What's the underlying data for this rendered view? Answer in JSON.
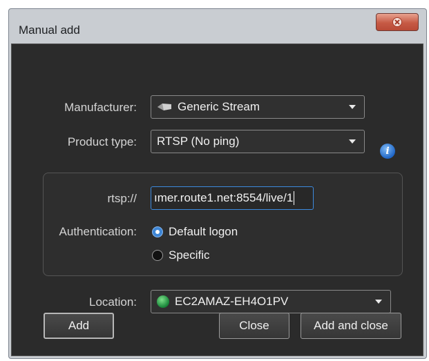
{
  "window": {
    "title": "Manual add"
  },
  "form": {
    "manufacturer": {
      "label": "Manufacturer:",
      "value": "Generic Stream",
      "icon": "generic-stream-icon"
    },
    "product_type": {
      "label": "Product type:",
      "value": "RTSP (No ping)"
    },
    "rtsp": {
      "label": "rtsp://",
      "value": "ımer.route1.net:8554/live/1"
    },
    "authentication": {
      "label": "Authentication:",
      "options": [
        {
          "label": "Default logon",
          "selected": true
        },
        {
          "label": "Specific",
          "selected": false
        }
      ]
    },
    "location": {
      "label": "Location:",
      "value": "EC2AMAZ-EH4O1PV",
      "icon": "globe-icon"
    }
  },
  "buttons": {
    "add": "Add",
    "close": "Close",
    "add_and_close": "Add and close"
  },
  "colors": {
    "accent": "#3e86d6",
    "panel": "#2b2b2b",
    "close_button": "#c65a45"
  }
}
